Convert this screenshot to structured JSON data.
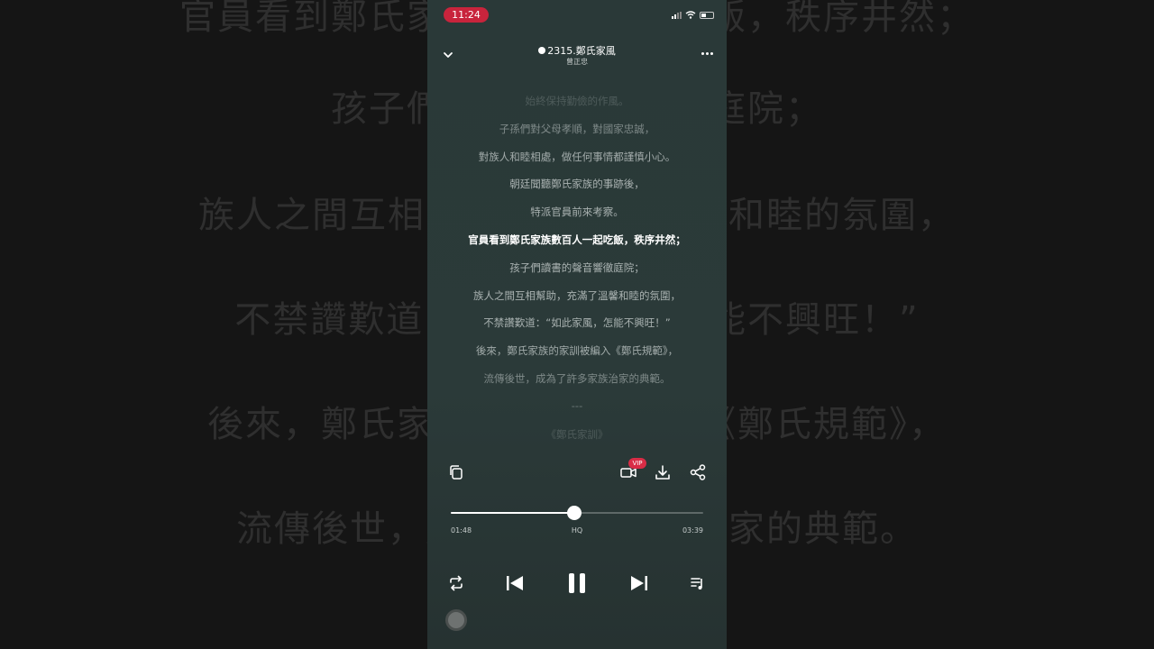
{
  "background": {
    "lines": [
      "官員看到鄭氏家族數百人一起吃飯，秩序井然；",
      "孩子們讀書的聲音響徹庭院；",
      "族人之間互相幫助，充滿了溫馨和睦的氛圍，",
      "不禁讚歎道：“如此家風，怎能不興旺！”",
      "後來，鄭氏家族的家訓被編入《鄭氏規範》，",
      "流傳後世，成為了許多家族治家的典範。"
    ]
  },
  "status_bar": {
    "time": "11:24"
  },
  "header": {
    "title": "2315.鄭氏家風",
    "artist": "曾正忠"
  },
  "lyrics": [
    {
      "text": "始終保持勤儉的作風。",
      "opacity": 0.25
    },
    {
      "text": "子孫們對父母孝順，對國家忠誠，",
      "opacity": 0.6
    },
    {
      "text": "對族人和睦相處，做任何事情都謹慎小心。",
      "opacity": 0.85
    },
    {
      "text": "朝廷聞聽鄭氏家族的事跡後，",
      "opacity": 0.9
    },
    {
      "text": "特派官員前來考察。",
      "opacity": 0.9
    },
    {
      "text": "官員看到鄭氏家族數百人一起吃飯，秩序井然；",
      "opacity": 1,
      "current": true
    },
    {
      "text": "孩子們讀書的聲音響徹庭院；",
      "opacity": 0.9
    },
    {
      "text": "族人之間互相幫助，充滿了溫馨和睦的氛圍，",
      "opacity": 0.9
    },
    {
      "text": "不禁讚歎道：“如此家風，怎能不興旺！”",
      "opacity": 0.9
    },
    {
      "text": "後來，鄭氏家族的家訓被編入《鄭氏規範》，",
      "opacity": 0.85
    },
    {
      "text": "流傳後世，成為了許多家族治家的典範。",
      "opacity": 0.6
    },
    {
      "text": "---",
      "opacity": 0.45
    },
    {
      "text": "《鄭氏家訓》",
      "opacity": 0.25
    }
  ],
  "actions": {
    "vip_badge": "VIP",
    "icons": [
      "copy-icon",
      "video-icon",
      "download-icon",
      "share-icon"
    ]
  },
  "player": {
    "elapsed": "01:48",
    "quality": "HQ",
    "duration": "03:39",
    "progress": 0.49
  },
  "controls": {
    "icons": [
      "repeat-icon",
      "previous-icon",
      "pause-icon",
      "next-icon",
      "playlist-icon"
    ]
  },
  "colors": {
    "accent": "#c8243c",
    "panel": "#2a3938"
  }
}
